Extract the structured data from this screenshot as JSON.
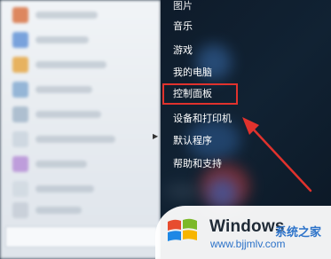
{
  "start_menu": {
    "right_items": [
      {
        "label": "图片"
      },
      {
        "label": "音乐"
      },
      {
        "label": "游戏"
      },
      {
        "label": "我的电脑"
      },
      {
        "label": "控制面板"
      },
      {
        "label": "设备和打印机"
      },
      {
        "label": "默认程序"
      },
      {
        "label": "帮助和支持"
      }
    ],
    "highlighted_item": "控制面板"
  },
  "watermark": {
    "brand": "Windows",
    "site_name": "系统之家",
    "url": "www.bjjmlv.com"
  },
  "colors": {
    "highlight": "#e0322d",
    "arrow": "#e0322d",
    "right_panel_bg": "#112233",
    "left_panel_bg": "#e9edf1",
    "watermark_text": "#2d73c9"
  }
}
